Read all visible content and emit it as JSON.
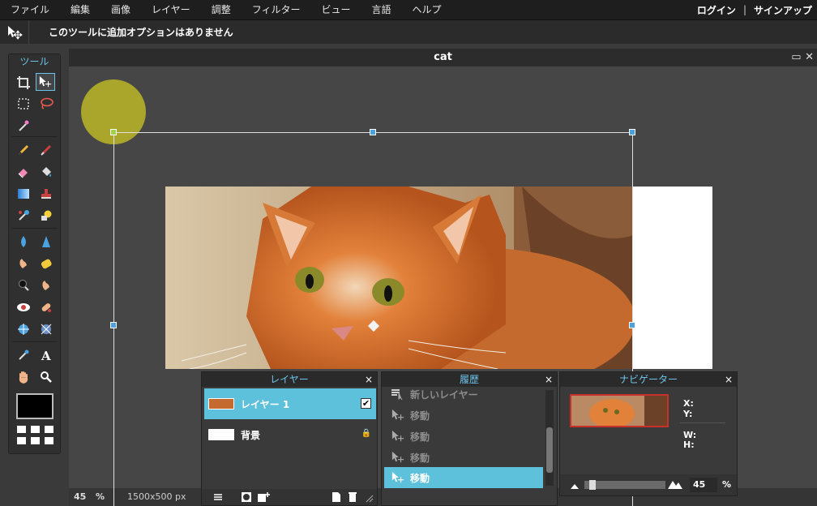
{
  "menubar": {
    "items": [
      "ファイル",
      "編集",
      "画像",
      "レイヤー",
      "調整",
      "フィルター",
      "ビュー",
      "言語",
      "ヘルプ"
    ],
    "login": "ログイン",
    "separator": "|",
    "signup": "サインアップ"
  },
  "options_bar": {
    "message": "このツールに追加オプションはありません"
  },
  "tools": {
    "title": "ツール"
  },
  "document": {
    "title": "cat",
    "zoom": "45",
    "zoom_unit": "%",
    "size": "1500x500 px"
  },
  "layers_panel": {
    "title": "レイヤー",
    "close": "×",
    "layers": [
      {
        "name": "レイヤー 1",
        "selected": true,
        "visible": "✔"
      },
      {
        "name": "背景",
        "selected": false,
        "lock": "🔒"
      }
    ]
  },
  "history_panel": {
    "title": "履歴",
    "close": "×",
    "entries": [
      {
        "label": "新しいレイヤー",
        "selected": false
      },
      {
        "label": "移動",
        "selected": false
      },
      {
        "label": "移動",
        "selected": false
      },
      {
        "label": "移動",
        "selected": false
      },
      {
        "label": "移動",
        "selected": true
      }
    ]
  },
  "navigator_panel": {
    "title": "ナビゲーター",
    "close": "×",
    "x_label": "X:",
    "y_label": "Y:",
    "w_label": "W:",
    "h_label": "H:",
    "zoom_value": "45",
    "zoom_unit": "%"
  },
  "colors": {
    "accent": "#6cc3ea",
    "selection": "#5ec1dc",
    "foreground": "#000000"
  }
}
